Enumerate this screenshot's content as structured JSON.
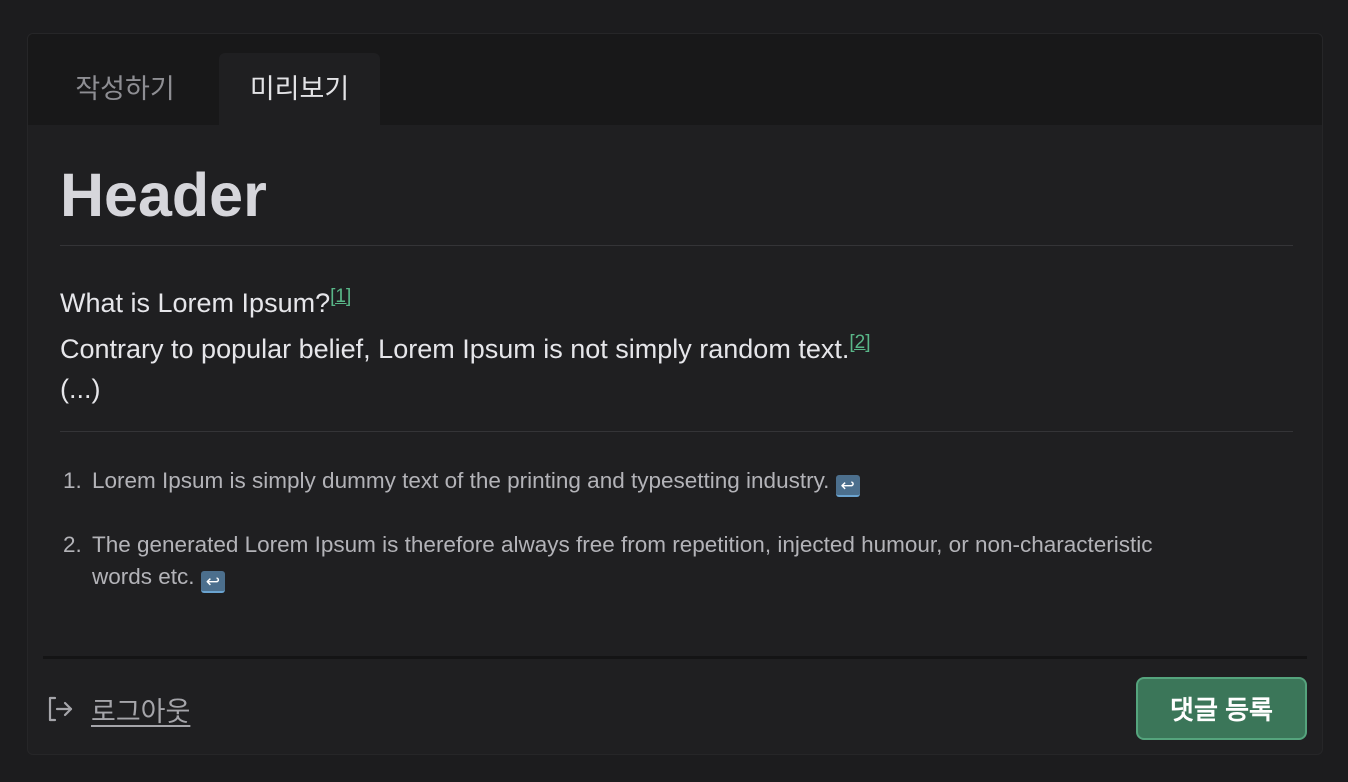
{
  "tabs": {
    "write_label": "작성하기",
    "preview_label": "미리보기"
  },
  "preview": {
    "header": "Header",
    "line1": "What is Lorem Ipsum?",
    "line1_ref": "[1]",
    "line2": "Contrary to popular belief, Lorem Ipsum is not simply random text.",
    "line2_ref": "[2]",
    "line3": "(...)"
  },
  "footnotes": [
    {
      "number": "1.",
      "text": "Lorem Ipsum is simply dummy text of the printing and typesetting industry.",
      "backref_icon": "↩"
    },
    {
      "number": "2.",
      "text": "The generated Lorem Ipsum is therefore always free from repetition, injected humour, or non-characteristic words etc.",
      "backref_icon": "↩"
    }
  ],
  "footer": {
    "logout_label": "로그아웃",
    "submit_label": "댓글 등록"
  },
  "colors": {
    "accent": "#3b7659",
    "link": "#59b688",
    "background": "#1c1c1e"
  }
}
